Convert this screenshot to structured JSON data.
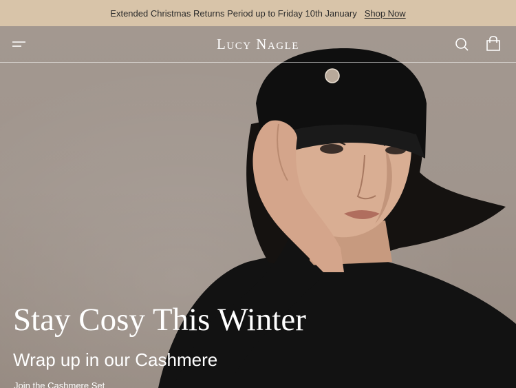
{
  "announcement": {
    "text": "Extended Christmas Returns Period up to Friday 10th January",
    "link": "Shop Now"
  },
  "header": {
    "logo": "Lucy Nagle",
    "icons": {
      "menu": "menu-icon",
      "search": "search-icon",
      "cart": "shopping-bag-icon"
    }
  },
  "hero": {
    "headline": "Stay Cosy This Winter",
    "subheadline": "Wrap up in our Cashmere",
    "cta": "Join the Cashmere Set"
  },
  "colors": {
    "announcement_bg": "#d8c4a9",
    "hero_bg": "#a0958d",
    "text_light": "#ffffff",
    "text_dark": "#2b2b2b"
  }
}
